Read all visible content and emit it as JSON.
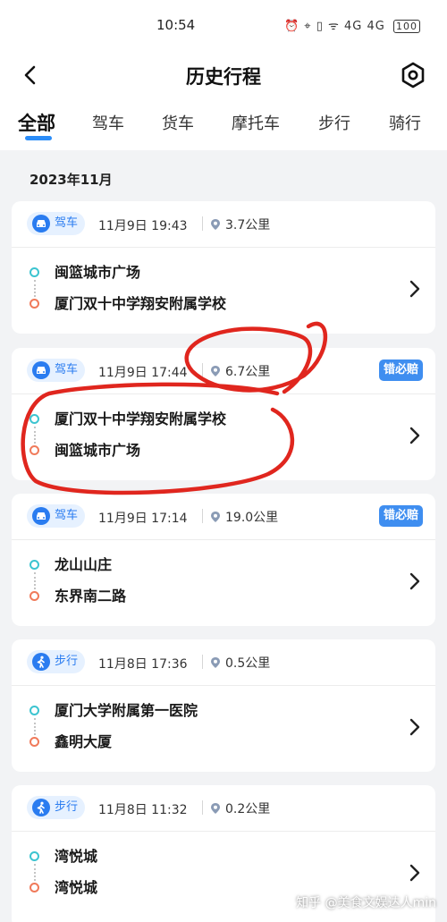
{
  "status_bar": {
    "time": "10:54",
    "indicators": "⏰ ⌖ ▯ ᯤ 4G 4G",
    "battery": "100"
  },
  "header": {
    "title": "历史行程",
    "back_icon": "back-arrow-icon",
    "settings_icon": "settings-hex-icon"
  },
  "tabs": [
    {
      "label": "全部",
      "active": true
    },
    {
      "label": "驾车",
      "active": false
    },
    {
      "label": "货车",
      "active": false
    },
    {
      "label": "摩托车",
      "active": false
    },
    {
      "label": "步行",
      "active": false
    },
    {
      "label": "骑行",
      "active": false
    }
  ],
  "month_label": "2023年11月",
  "trips": [
    {
      "mode": "驾车",
      "mode_icon": "car-icon",
      "datetime": "11月9日 19:43",
      "distance": "3.7公里",
      "insure": "",
      "from": "闽篮城市广场",
      "to": "厦门双十中学翔安附属学校"
    },
    {
      "mode": "驾车",
      "mode_icon": "car-icon",
      "datetime": "11月9日 17:44",
      "distance": "6.7公里",
      "insure": "错必赔",
      "from": "厦门双十中学翔安附属学校",
      "to": "闽篮城市广场"
    },
    {
      "mode": "驾车",
      "mode_icon": "car-icon",
      "datetime": "11月9日 17:14",
      "distance": "19.0公里",
      "insure": "错必赔",
      "from": "龙山山庄",
      "to": "东界南二路"
    },
    {
      "mode": "步行",
      "mode_icon": "walk-icon",
      "datetime": "11月8日 17:36",
      "distance": "0.5公里",
      "insure": "",
      "from": "厦门大学附属第一医院",
      "to": "鑫明大厦"
    },
    {
      "mode": "步行",
      "mode_icon": "walk-icon",
      "datetime": "11月8日 11:32",
      "distance": "0.2公里",
      "insure": "",
      "from": "湾悦城",
      "to": "湾悦城"
    }
  ],
  "watermark": "知乎 @美食文娱达人min",
  "colors": {
    "accent": "#2a8cf8",
    "start_dot": "#3cc4d0",
    "end_dot": "#f07a5a",
    "annotation": "#e0261e"
  }
}
